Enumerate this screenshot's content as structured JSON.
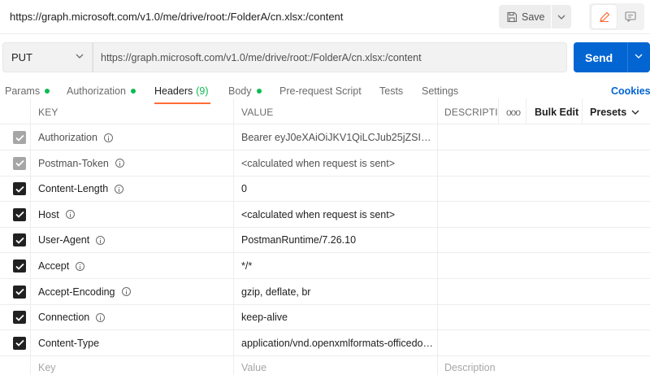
{
  "window": {
    "title": "https://graph.microsoft.com/v1.0/me/drive/root:/FolderA/cn.xlsx:/content",
    "save_label": "Save"
  },
  "request": {
    "method": "PUT",
    "url": "https://graph.microsoft.com/v1.0/me/drive/root:/FolderA/cn.xlsx:/content",
    "send_label": "Send"
  },
  "tabs": [
    {
      "label": "Params",
      "dot": true
    },
    {
      "label": "Authorization",
      "dot": true
    },
    {
      "label": "Headers",
      "count": "(9)",
      "active": true
    },
    {
      "label": "Body",
      "dot": true
    },
    {
      "label": "Pre-request Script"
    },
    {
      "label": "Tests"
    },
    {
      "label": "Settings"
    }
  ],
  "cookies_label": "Cookies",
  "table": {
    "columns": {
      "key": "KEY",
      "value": "VALUE",
      "description": "DESCRIPTIC"
    },
    "more_label": "ooo",
    "bulk_edit_label": "Bulk Edit",
    "presets_label": "Presets",
    "rows": [
      {
        "key": "Authorization",
        "value": "Bearer eyJ0eXAiOiJKV1QiLCJub25jZSI6lk…",
        "info": true,
        "auto": true
      },
      {
        "key": "Postman-Token",
        "value": "<calculated when request is sent>",
        "info": true,
        "auto": true
      },
      {
        "key": "Content-Length",
        "value": "0",
        "info": true,
        "auto": false
      },
      {
        "key": "Host",
        "value": "<calculated when request is sent>",
        "info": true,
        "auto": false
      },
      {
        "key": "User-Agent",
        "value": "PostmanRuntime/7.26.10",
        "info": true,
        "auto": false
      },
      {
        "key": "Accept",
        "value": "*/*",
        "info": true,
        "auto": false
      },
      {
        "key": "Accept-Encoding",
        "value": "gzip, deflate, br",
        "info": true,
        "auto": false
      },
      {
        "key": "Connection",
        "value": "keep-alive",
        "info": true,
        "auto": false
      },
      {
        "key": "Content-Type",
        "value": "application/vnd.openxmlformats-officedo…",
        "info": false,
        "auto": false
      }
    ],
    "placeholders": {
      "key": "Key",
      "value": "Value",
      "description": "Description"
    }
  },
  "colors": {
    "accent": "#0265d2",
    "tab_active_underline": "#ff6c37",
    "status_dot": "#0cbb52"
  }
}
